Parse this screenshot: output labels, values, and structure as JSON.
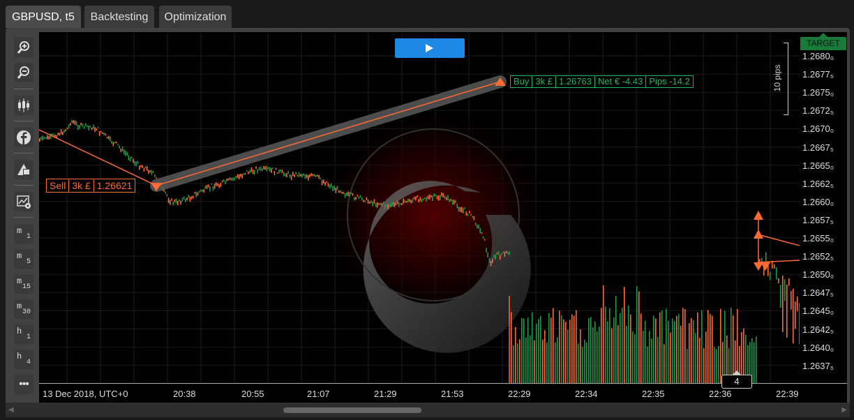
{
  "tabs": [
    {
      "label": "GBPUSD, t5",
      "active": true
    },
    {
      "label": "Backtesting",
      "active": false
    },
    {
      "label": "Optimization",
      "active": false
    }
  ],
  "toolbar": {
    "buttons": [
      {
        "name": "zoom-in-icon"
      },
      {
        "name": "zoom-out-icon"
      },
      {
        "name": "candlestick-icon"
      },
      {
        "name": "facebook-icon"
      },
      {
        "name": "draw-tools-icon"
      },
      {
        "name": "chart-settings-icon"
      }
    ],
    "timeframes": [
      {
        "a": "m",
        "b": "1"
      },
      {
        "a": "m",
        "b": "5"
      },
      {
        "a": "m",
        "b": "15"
      },
      {
        "a": "m",
        "b": "30"
      },
      {
        "a": "h",
        "b": "1"
      },
      {
        "a": "h",
        "b": "4"
      }
    ],
    "more_label": "•••"
  },
  "chart": {
    "symbol": "GBPUSD",
    "colors": {
      "bull": "#1e9a4a",
      "bear": "#ff6a33",
      "play": "#1e88e5"
    },
    "sell_label": {
      "side": "Sell",
      "volume": "3k £",
      "price": "1.26621"
    },
    "buy_label": {
      "side": "Buy",
      "volume": "3k £",
      "price": "1.26763",
      "net": "Net € -4.43",
      "pips": "Pips -14.2"
    },
    "target_label": "TARGET",
    "pips_label": "10 pips",
    "marker_count": "4",
    "price_labels": [
      "1.2680₀",
      "1.2677₅",
      "1.2675₀",
      "1.2672₅",
      "1.2670₀",
      "1.2667₅",
      "1.2665₀",
      "1.2662₅",
      "1.2660₀",
      "1.2657₅",
      "1.2655₀",
      "1.2652₅",
      "1.2650₀",
      "1.2647₅",
      "1.2645₀",
      "1.2642₅",
      "1.2640₀",
      "1.2637₅"
    ],
    "time_labels": [
      "13 Dec 2018, UTC+0",
      "20:38",
      "20:55",
      "21:07",
      "21:29",
      "21:53",
      "22:29",
      "22:34",
      "22:35",
      "22:36",
      "22:39"
    ]
  }
}
